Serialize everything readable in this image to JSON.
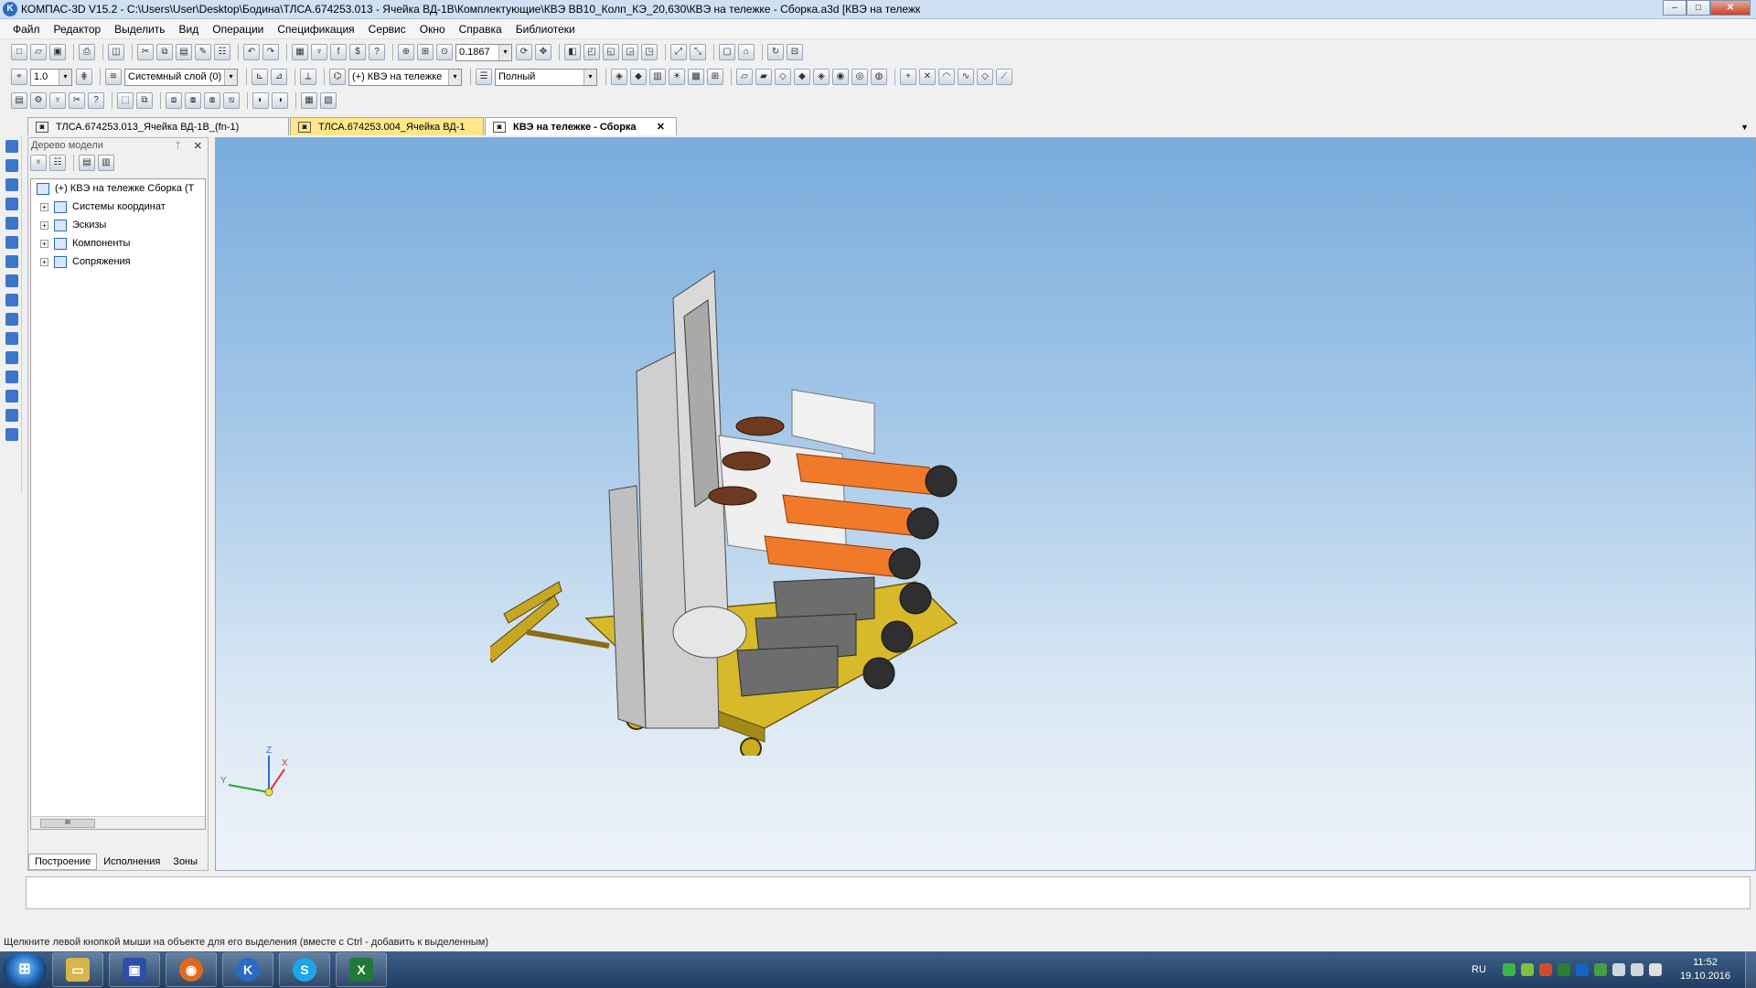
{
  "window": {
    "title": "КОМПАС-3D V15.2 - C:\\Users\\User\\Desktop\\Бодина\\ТЛСА.674253.013 - Ячейка ВД-1В\\Комплектующие\\КВЭ ВВ10_Колп_КЭ_20,630\\КВЭ на тележке - Сборка.a3d [КВЭ на тележк",
    "app_icon": "K",
    "minimize": "–",
    "maximize": "□",
    "close": "✕"
  },
  "menu": [
    "Файл",
    "Редактор",
    "Выделить",
    "Вид",
    "Операции",
    "Спецификация",
    "Сервис",
    "Окно",
    "Справка",
    "Библиотеки"
  ],
  "toolbar": {
    "zoom_value": "0.1867",
    "step_value": "1.0",
    "layer": "Системный слой (0)",
    "component": "(+) КВЭ на тележке",
    "display_mode": "Полный",
    "combo_arrow": "▾"
  },
  "tabs": [
    {
      "label": "ТЛСА.674253.013_Ячейка ВД-1В_(fn-1)"
    },
    {
      "label": "ТЛСА.674253.004_Ячейка ВД-1"
    },
    {
      "label": "КВЭ на тележке - Сборка",
      "close": "✕"
    }
  ],
  "tabs_dropdown": "▼",
  "tree_panel": {
    "title": "Дерево модели",
    "pin": "ᛘ",
    "close": "✕",
    "root": "(+) КВЭ на тележке Сборка (Т",
    "expander": "+",
    "nodes": [
      "Системы координат",
      "Эскизы",
      "Компоненты",
      "Сопряжения"
    ],
    "scroll_thumb": "III",
    "bottom_tabs": [
      "Построение",
      "Исполнения",
      "Зоны"
    ]
  },
  "viewport": {
    "axis_z": "Z",
    "axis_x": "X",
    "axis_y": "Y"
  },
  "status_text": "Щелкните левой кнопкой мыши на объекте для его выделения (вместе с Ctrl - добавить к выделенным)",
  "taskbar": {
    "start_label": "⊞",
    "apps": [
      {
        "name": "explorer",
        "glyph": "▭",
        "color": "#d8b54a"
      },
      {
        "name": "save",
        "glyph": "▣",
        "color": "#2d4fa8"
      },
      {
        "name": "firefox",
        "glyph": "◉",
        "color": "#e06a1c"
      },
      {
        "name": "kompas",
        "glyph": "K",
        "color": "#2a6cc4"
      },
      {
        "name": "skype",
        "glyph": "S",
        "color": "#1ea5e6"
      },
      {
        "name": "excel",
        "glyph": "X",
        "color": "#1f7a3a"
      }
    ],
    "language": "RU",
    "time": "11:52",
    "date": "19.10.2016"
  },
  "colors": {
    "accent": "#2a6cc4",
    "active_tab_yellow": "#ffe78b",
    "viewport_top": "#79acdc",
    "viewport_bottom": "#eef3f9",
    "model_orange": "#f07a2a",
    "model_yellow": "#d7b92a",
    "model_gray": "#6d6d6d"
  }
}
